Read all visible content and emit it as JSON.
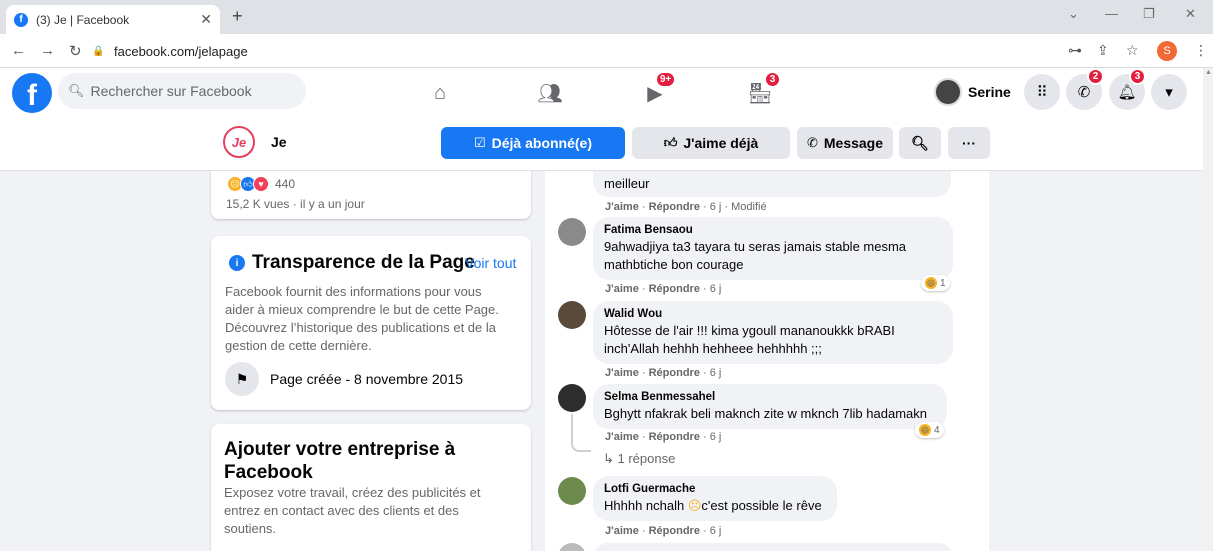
{
  "browser": {
    "tab_title": "(3) Je | Facebook",
    "url": "facebook.com/jelapage",
    "profile_initial": "S"
  },
  "header": {
    "search_placeholder": "Rechercher sur Facebook",
    "watch_badge": "9+",
    "marketplace_badge": "3",
    "user_name": "Serine",
    "messenger_badge": "2",
    "notifications_badge": "3"
  },
  "page": {
    "avatar_text": "Je",
    "name": "Je",
    "subscribed_label": "Déjà abonné(e)",
    "liked_label": "J'aime déjà",
    "message_label": "Message"
  },
  "post": {
    "reactions_count": "440",
    "views": "15,2 K vues · il y a un jour"
  },
  "transparency": {
    "title": "Transparence de la Page",
    "see_all": "Voir tout",
    "description": "Facebook fournit des informations pour vous aider à mieux comprendre le but de cette Page. Découvrez l’historique des publications et de la gestion de cette dernière.",
    "created": "Page créée - 8 novembre 2015"
  },
  "business": {
    "title": "Ajouter votre entreprise à Facebook",
    "description": "Exposez votre travail, créez des publicités et entrez en contact avec des clients et des soutiens."
  },
  "comments": {
    "c0": {
      "text": "meilleur",
      "meta_like": "J'aime",
      "meta_reply": "Répondre",
      "meta_rest": " · 6 j · Modifié"
    },
    "c1": {
      "name": "Fatima Bensaou",
      "text": "9ahwadjiya ta3 tayara tu seras jamais stable mesma mathbtiche bon courage",
      "meta_like": "J'aime",
      "meta_reply": "Répondre",
      "meta_rest": " · 6 j",
      "reactions": "1"
    },
    "c2": {
      "name": "Walid Wou",
      "text": "Hôtesse de l'air !!! kima ygoull mananoukkk bRABI inch'Allah hehhh hehheee hehhhhh ;;;",
      "meta_like": "J'aime",
      "meta_reply": "Répondre",
      "meta_rest": " · 6 j"
    },
    "c3": {
      "name": "Selma Benmessahel",
      "text": "Bghytt nfakrak beli maknch zite w mknch 7lib hadamakn",
      "meta_like": "J'aime",
      "meta_reply": "Répondre",
      "meta_rest": " · 6 j",
      "reactions": "4",
      "replies": "1 réponse"
    },
    "c4": {
      "name": "Lotfi Guermache",
      "text_a": "Hhhhh nchalh ",
      "text_b": "c'est possible le rêve",
      "meta_like": "J'aime",
      "meta_reply": "Répondre",
      "meta_rest": " · 6 j"
    }
  }
}
